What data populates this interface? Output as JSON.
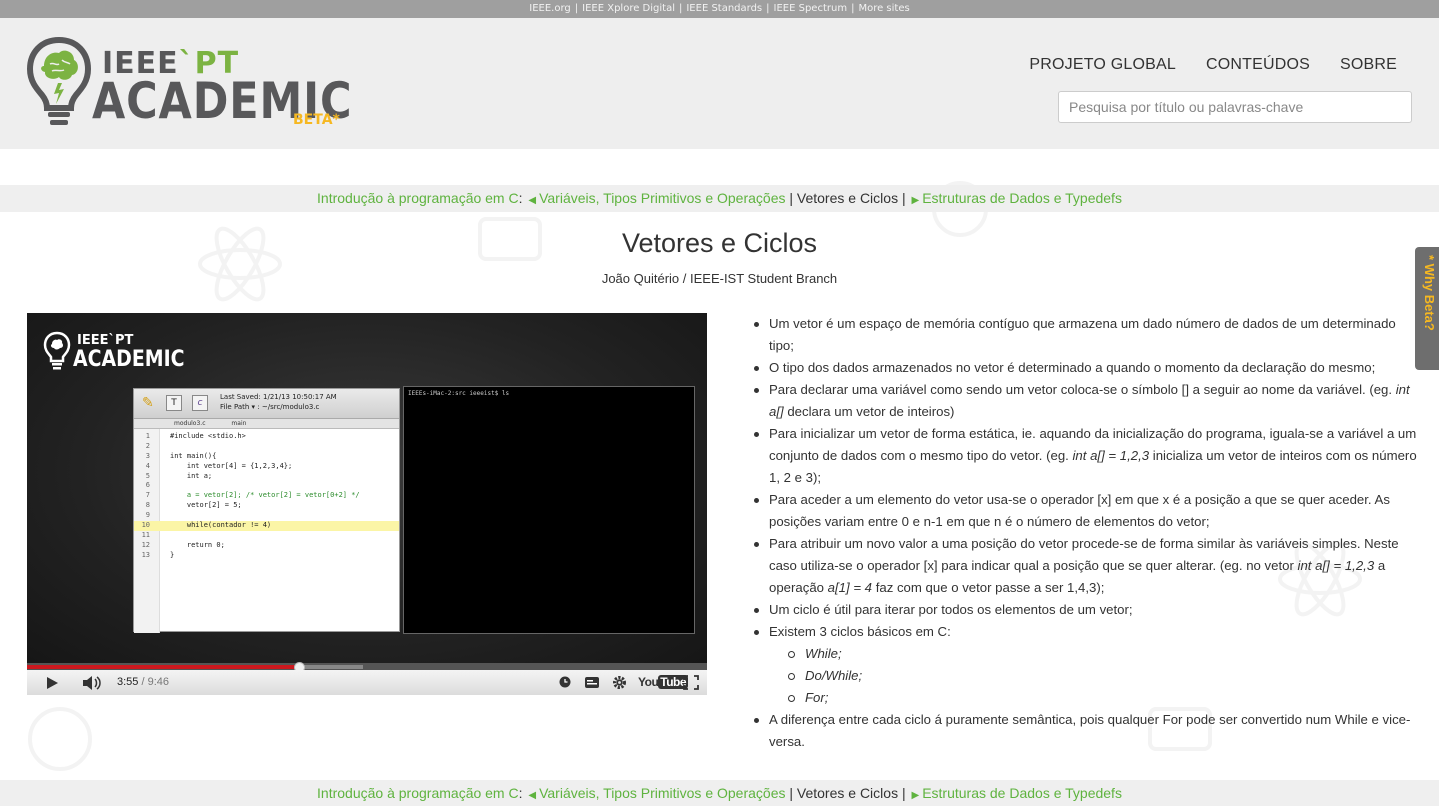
{
  "top_links": [
    "IEEE.org",
    "IEEE Xplore Digital",
    "IEEE Standards",
    "IEEE Spectrum",
    "More sites"
  ],
  "logo": {
    "line1_a": "IEEE",
    "line1_b": "`PT",
    "line2": "ACADEMIC",
    "beta": "BETA*"
  },
  "nav": {
    "item1": "PROJETO GLOBAL",
    "item2": "CONTEÚDOS",
    "item3": "SOBRE"
  },
  "search": {
    "placeholder": "Pesquisa por título ou palavras-chave",
    "value": ""
  },
  "breadcrumb": {
    "course": "Introdução à programação em C",
    "sep_colon": ":",
    "prev": "Variáveis, Tipos Primitivos e Operações",
    "current": "Vetores e Ciclos",
    "next": "Estruturas de Dados e Typedefs",
    "pipe": "|"
  },
  "page": {
    "title": "Vetores e Ciclos",
    "author": "João Quitério / IEEE-IST Student Branch"
  },
  "video": {
    "logo_line1": "IEEE`PT",
    "logo_line2": "ACADEMIC",
    "editor": {
      "saved": "Last Saved: 1/21/13 10:50:17 AM",
      "path": "File Path ▾ : ~/src/modulo3.c",
      "tab_file": "modulo3.c",
      "tab_func": "main",
      "lines": [
        {
          "n": "1",
          "t": "#include <stdio.h>"
        },
        {
          "n": "2",
          "t": ""
        },
        {
          "n": "3",
          "t": "int main(){"
        },
        {
          "n": "4",
          "t": "    int vetor[4] = {1,2,3,4};"
        },
        {
          "n": "5",
          "t": "    int a;"
        },
        {
          "n": "6",
          "t": ""
        },
        {
          "n": "7",
          "t": "    a = vetor[2]; /* vetor[2] = vetor[0+2] */"
        },
        {
          "n": "8",
          "t": "    vetor[2] = 5;"
        },
        {
          "n": "9",
          "t": ""
        },
        {
          "n": "10",
          "t": "    while(contador != 4)"
        },
        {
          "n": "11",
          "t": ""
        },
        {
          "n": "12",
          "t": "    return 0;"
        },
        {
          "n": "13",
          "t": "}"
        }
      ]
    },
    "terminal_prompt": "IEEEs-iMac-2:src ieeeist$ ls",
    "time_current": "3:55",
    "time_sep": " / ",
    "time_duration": "9:46",
    "progress_played": 0.402,
    "progress_buffered": 0.494,
    "youtube_you": "You",
    "youtube_tube": "Tube"
  },
  "content": {
    "b1": "Um vetor é um espaço de memória contíguo que armazena um dado número de dados de um determinado tipo;",
    "b2": "O tipo dos dados armazenados no vetor é determinado a quando o momento da declaração do mesmo;",
    "b3_pre": "Para declarar uma variável como sendo um vetor coloca-se o símbolo [] a seguir ao nome da variável. (eg. ",
    "b3_em": "int a[]",
    "b3_post": " declara um vetor de inteiros)",
    "b4_pre": "Para inicializar um vetor de forma estática, ie. aquando da inicialização do programa, iguala-se a variável a um conjunto de dados com o mesmo tipo do vetor. (eg. ",
    "b4_em": "int a[] = 1,2,3",
    "b4_post": " inicializa um vetor de inteiros com os número 1, 2 e 3);",
    "b5": "Para aceder a um elemento do vetor usa-se o operador [x] em que x é a posição a que se quer aceder. As posições variam entre 0 e n-1 em que n é o número de elementos do vetor;",
    "b6_pre": "Para atribuir um novo valor a uma posição do vetor procede-se de forma similar às variáveis simples. Neste caso utiliza-se o operador [x] para indicar qual a posição que se quer alterar. (eg. no vetor ",
    "b6_em1": "int a[] = 1,2,3",
    "b6_mid": " a operação ",
    "b6_em2": "a[1] = 4",
    "b6_post": " faz com que o vetor passe a ser 1,4,3);",
    "b7": "Um ciclo é útil para iterar por todos os elementos de um vetor;",
    "b8": "Existem 3 ciclos básicos em C:",
    "sub": [
      "While;",
      "Do/While;",
      "For;"
    ],
    "b9": "A diferença entre cada ciclo á puramente semântica, pois qualquer For pode ser convertido num While e vice-versa."
  },
  "why_beta": "* Why Beta?",
  "colors": {
    "accent_green": "#5fb33f",
    "beta_yellow": "#f6b821",
    "logo_gray": "#58585a",
    "progress_red": "#cc181e"
  },
  "icons": [
    "lightbulb-brain-icon",
    "play-icon",
    "volume-icon",
    "clock-icon",
    "captions-icon",
    "gear-icon",
    "fullscreen-icon",
    "chevron-left-icon",
    "chevron-right-icon"
  ]
}
